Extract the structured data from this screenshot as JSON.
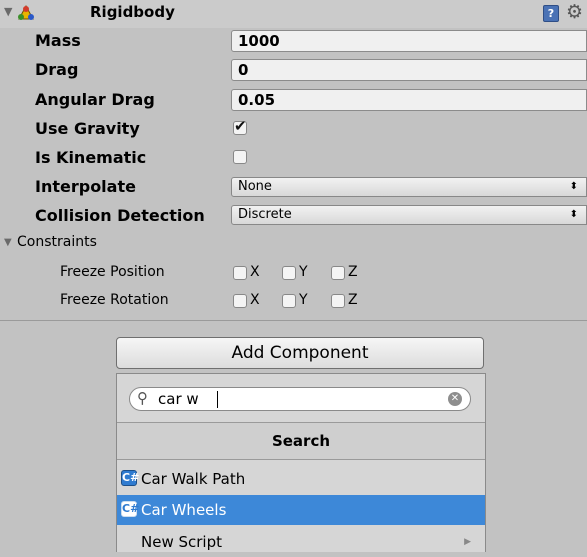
{
  "component": {
    "title": "Rigidbody",
    "help_glyph": "?",
    "gear_glyph": "⚙",
    "collapse_glyph": "▼"
  },
  "properties": {
    "mass": {
      "label": "Mass",
      "value": "1000"
    },
    "drag": {
      "label": "Drag",
      "value": "0"
    },
    "angular_drag": {
      "label": "Angular Drag",
      "value": "0.05"
    },
    "use_gravity": {
      "label": "Use Gravity",
      "checked": true,
      "mark": "✔"
    },
    "is_kinematic": {
      "label": "Is Kinematic",
      "checked": false
    },
    "interpolate": {
      "label": "Interpolate",
      "value": "None"
    },
    "collision_detection": {
      "label": "Collision Detection",
      "value": "Discrete"
    }
  },
  "dropdown_arrow": "⬍",
  "constraints": {
    "label": "Constraints",
    "freeze_position": {
      "label": "Freeze Position",
      "axes": [
        "X",
        "Y",
        "Z"
      ]
    },
    "freeze_rotation": {
      "label": "Freeze Rotation",
      "axes": [
        "X",
        "Y",
        "Z"
      ]
    }
  },
  "add_component": {
    "button_label": "Add Component",
    "search_icon": "⚲",
    "search_value": "car w",
    "clear_glyph": "✕",
    "header": "Search",
    "cs_glyph": "C#",
    "results": [
      {
        "label": "Car Walk Path",
        "selected": false
      },
      {
        "label": "Car Wheels",
        "selected": true
      }
    ],
    "new_script": "New Script",
    "more_glyph": "▶"
  },
  "colors": {
    "selection": "#3d88d8",
    "panel_bg": "#c2c2c2"
  }
}
